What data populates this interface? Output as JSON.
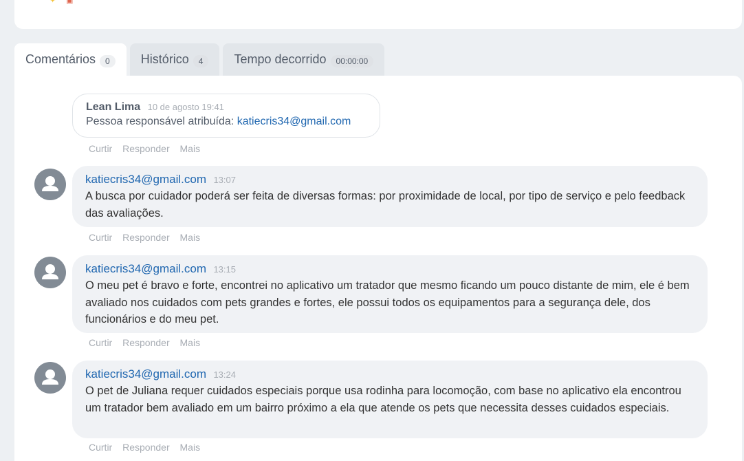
{
  "tabs": [
    {
      "label": "Comentários",
      "count": "0"
    },
    {
      "label": "Histórico",
      "count": "4"
    },
    {
      "label": "Tempo decorrido",
      "count": "00:00:00"
    }
  ],
  "system_entry": {
    "author": "Lean Lima",
    "time": "10 de agosto 19:41",
    "text_prefix": "Pessoa responsável atribuída: ",
    "email": "katiecris34@gmail.com"
  },
  "actions": {
    "like": "Curtir",
    "reply": "Responder",
    "more": "Mais"
  },
  "comments": [
    {
      "author": "katiecris34@gmail.com",
      "time": "13:07",
      "text": "A busca por cuidador poderá ser feita de diversas formas: por proximidade de local, por tipo de serviço e pelo feedback das avaliações."
    },
    {
      "author": "katiecris34@gmail.com",
      "time": "13:15",
      "text": "O meu pet é bravo e forte, encontrei no aplicativo um tratador que mesmo ficando um pouco distante de mim, ele é bem avaliado nos cuidados com pets grandes e fortes, ele possui todos os equipamentos para a segurança dele, dos funcionários e do meu pet."
    },
    {
      "author": "katiecris34@gmail.com",
      "time": "13:24",
      "text": "O pet de Juliana requer cuidados especiais porque usa rodinha para locomoção, com base no aplicativo ela encontrou um tratador bem avaliado em um bairro próximo a ela que atende os pets que necessita desses cuidados especiais."
    }
  ]
}
